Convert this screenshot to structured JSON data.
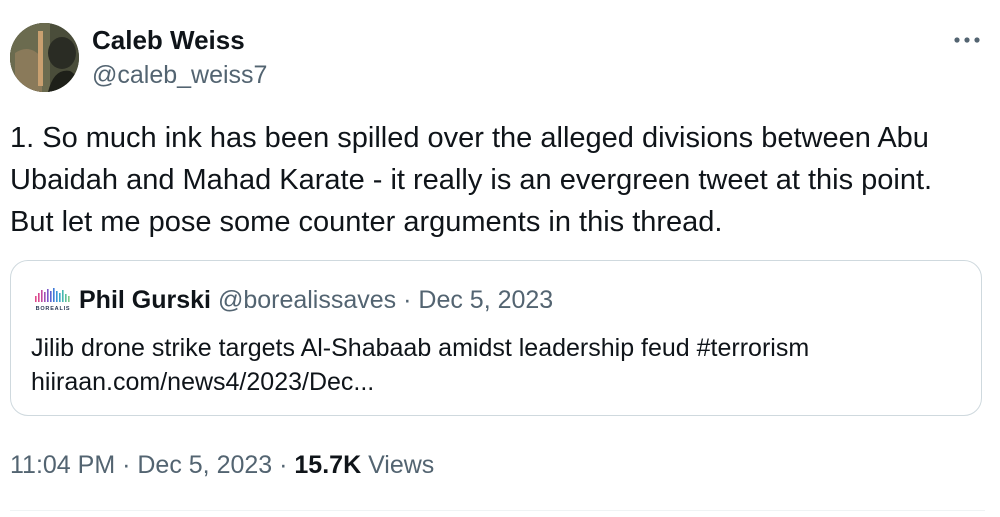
{
  "author": {
    "display_name": "Caleb Weiss",
    "handle": "@caleb_weiss7",
    "avatar_icon": "profile-photo"
  },
  "more_icon": "more-horizontal-icon",
  "tweet": {
    "lines": [
      "1. So much ink has been spilled over the alleged divisions between Abu",
      "Ubaidah and Mahad Karate - it really is an evergreen tweet at this point.",
      "But let me pose some counter arguments in this thread."
    ]
  },
  "quote": {
    "logo_icon": "borealis-logo",
    "logo_text": "BOREALIS",
    "display_name": "Phil Gurski",
    "handle_date": "@borealissaves · Dec 5, 2023",
    "lines": [
      "Jilib drone strike targets Al-Shabaab amidst leadership feud #terrorism",
      "hiiraan.com/news4/2023/Dec..."
    ]
  },
  "meta": {
    "time_date": "11:04 PM · Dec 5, 2023 · ",
    "views_count": "15.7K",
    "views_label": " Views"
  },
  "colors": {
    "text_primary": "#0f1419",
    "text_secondary": "#536471",
    "border": "#cfd9de"
  }
}
